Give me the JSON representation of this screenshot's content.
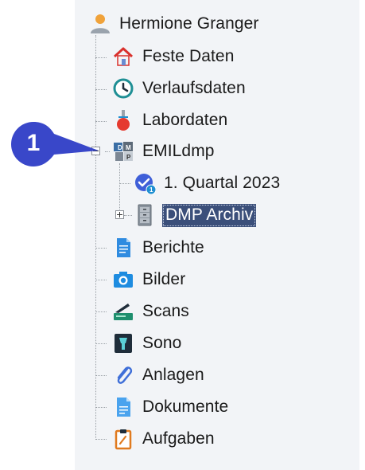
{
  "tree": {
    "root": {
      "label": "Hermione Granger",
      "icon": "person-icon"
    },
    "items": [
      {
        "label": "Feste Daten",
        "icon": "house-icon"
      },
      {
        "label": "Verlaufsdaten",
        "icon": "clock-icon"
      },
      {
        "label": "Labordaten",
        "icon": "flask-icon"
      },
      {
        "label": "EMILdmp",
        "icon": "dmp-puzzle-icon",
        "expanded": true,
        "children": [
          {
            "label": "1. Quartal 2023",
            "icon": "check-badge-icon",
            "badge": "1"
          },
          {
            "label": "DMP Archiv",
            "icon": "file-cabinet-icon",
            "selected": true,
            "collapsed": true
          }
        ]
      },
      {
        "label": "Berichte",
        "icon": "document-icon"
      },
      {
        "label": "Bilder",
        "icon": "camera-icon"
      },
      {
        "label": "Scans",
        "icon": "scanner-icon"
      },
      {
        "label": "Sono",
        "icon": "ultrasound-icon"
      },
      {
        "label": "Anlagen",
        "icon": "paperclip-icon"
      },
      {
        "label": "Dokumente",
        "icon": "document-icon"
      },
      {
        "label": "Aufgaben",
        "icon": "clipboard-icon"
      }
    ]
  },
  "callout": {
    "number": "1",
    "color": "#3947c9"
  },
  "colors": {
    "selection": "#3b4f7a",
    "panel": "#f2f4f7",
    "text": "#1a1a1a"
  }
}
